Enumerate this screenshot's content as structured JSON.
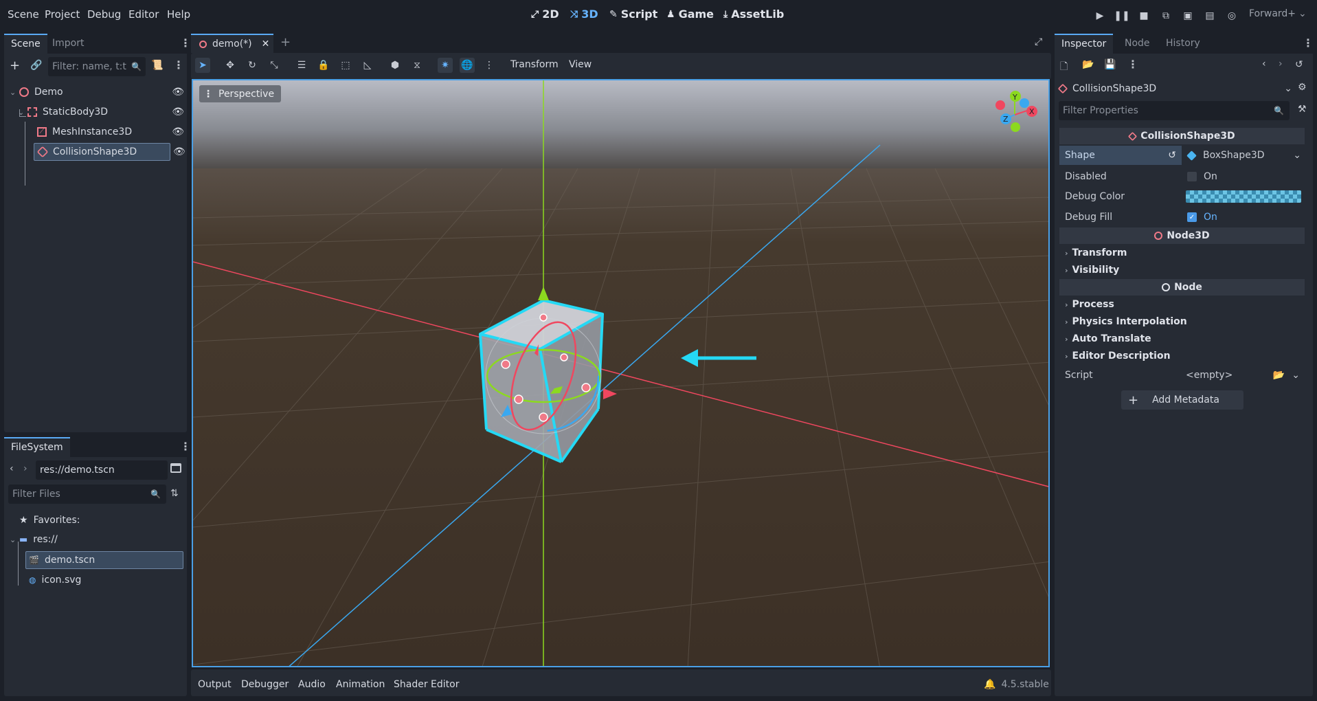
{
  "menu": [
    "Scene",
    "Project",
    "Debug",
    "Editor",
    "Help"
  ],
  "workspaces": [
    {
      "label": "2D",
      "icon": "⤢"
    },
    {
      "label": "3D",
      "icon": "⤨"
    },
    {
      "label": "Script",
      "icon": "✎"
    },
    {
      "label": "Game",
      "icon": "♟"
    },
    {
      "label": "AssetLib",
      "icon": "⤓"
    }
  ],
  "renderer": "Forward+",
  "scene_dock": {
    "tabs": [
      "Scene",
      "Import"
    ],
    "filter_placeholder": "Filter: name, t:t",
    "tree": [
      {
        "label": "Demo",
        "icon": "node3d-icon"
      },
      {
        "label": "StaticBody3D",
        "icon": "staticbody-icon"
      },
      {
        "label": "MeshInstance3D",
        "icon": "mesh-icon"
      },
      {
        "label": "CollisionShape3D",
        "icon": "collision-icon"
      }
    ]
  },
  "filesystem": {
    "tab": "FileSystem",
    "path": "res://demo.tscn",
    "filter_placeholder": "Filter Files",
    "favorites": "Favorites:",
    "items": [
      {
        "label": "res://"
      },
      {
        "label": "demo.tscn"
      },
      {
        "label": "icon.svg"
      }
    ]
  },
  "editor": {
    "tab": "demo(*)",
    "toolbar_menus": [
      "Transform",
      "View"
    ],
    "perspective": "Perspective",
    "gizmo": {
      "y": "Y",
      "x": "X",
      "z": "Z"
    }
  },
  "inspector": {
    "tabs": [
      "Inspector",
      "Node",
      "History"
    ],
    "node": "CollisionShape3D",
    "filter_placeholder": "Filter Properties",
    "section_collision": "CollisionShape3D",
    "props": {
      "shape_label": "Shape",
      "shape_value": "BoxShape3D",
      "disabled_label": "Disabled",
      "disabled_value": "On",
      "debug_color_label": "Debug Color",
      "debug_fill_label": "Debug Fill",
      "debug_fill_value": "On"
    },
    "section_node3d": "Node3D",
    "node3d_groups": [
      "Transform",
      "Visibility"
    ],
    "section_node": "Node",
    "node_groups": [
      "Process",
      "Physics Interpolation",
      "Auto Translate",
      "Editor Description"
    ],
    "script_label": "Script",
    "script_value": "<empty>",
    "add_metadata": "Add Metadata"
  },
  "bottom_panel": {
    "tabs": [
      "Output",
      "Debugger",
      "Audio",
      "Animation",
      "Shader Editor"
    ],
    "version": "4.5.stable"
  },
  "colors": {
    "accent": "#66b4ff",
    "selection_cyan": "#25d9f5",
    "axis_x": "#f0475f",
    "axis_y": "#8cd91f",
    "axis_z": "#3aa8f0"
  }
}
